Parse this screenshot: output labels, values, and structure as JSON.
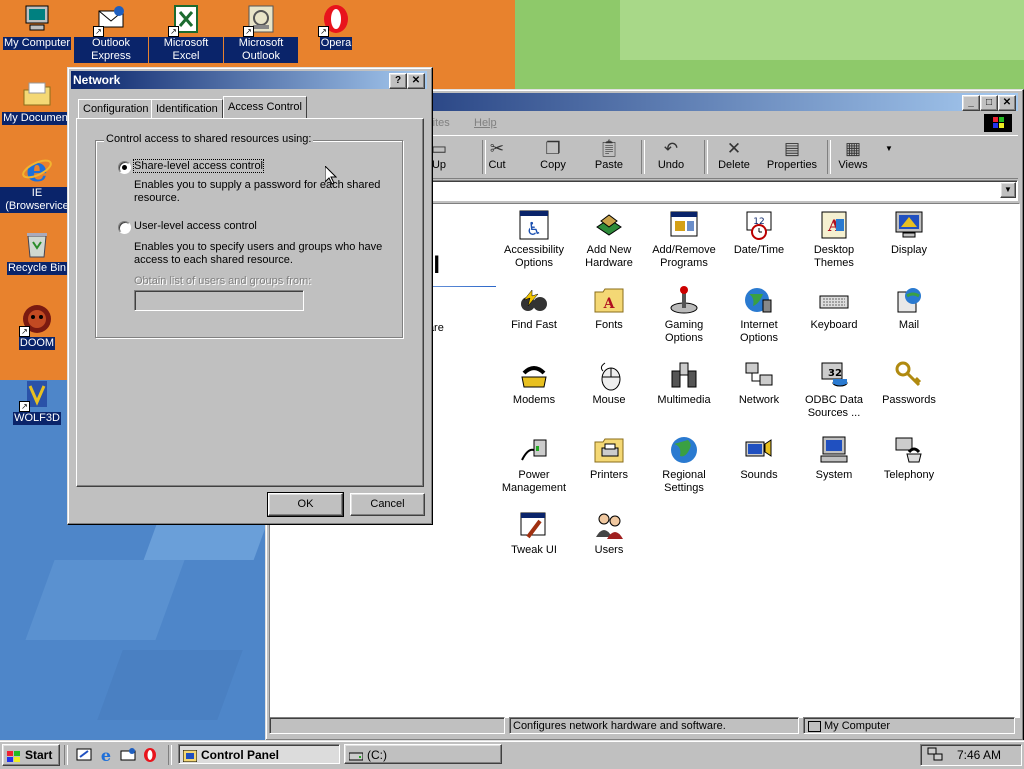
{
  "desktop": {
    "icons": [
      {
        "name": "my-computer-icon",
        "label": "My Computer"
      },
      {
        "name": "outlook-express-icon",
        "label": "Outlook Express"
      },
      {
        "name": "microsoft-excel-icon",
        "label": "Microsoft Excel"
      },
      {
        "name": "microsoft-outlook-icon",
        "label": "Microsoft Outlook"
      },
      {
        "name": "opera-icon",
        "label": "Opera"
      },
      {
        "name": "my-documents-icon",
        "label": "My Document"
      },
      {
        "name": "ie-browser-icon",
        "label": "IE (Browservice"
      },
      {
        "name": "recycle-bin-icon",
        "label": "Recycle Bin"
      },
      {
        "name": "doom-icon",
        "label": "DOOM"
      },
      {
        "name": "wolf3d-icon",
        "label": "WOLF3D"
      }
    ]
  },
  "control_panel": {
    "menu": {
      "favorites": "rites",
      "help": "Help"
    },
    "toolbar": {
      "up": "Up",
      "cut": "Cut",
      "copy": "Copy",
      "paste": "Paste",
      "undo": "Undo",
      "delete": "Delete",
      "properties": "Properties",
      "views": "Views"
    },
    "side_title": "el",
    "side_text": "ware",
    "items": [
      {
        "label": "Accessibility Options"
      },
      {
        "label": "Add New Hardware"
      },
      {
        "label": "Add/Remove Programs"
      },
      {
        "label": "Date/Time"
      },
      {
        "label": "Desktop Themes"
      },
      {
        "label": "Display"
      },
      {
        "label": "Find Fast"
      },
      {
        "label": "Fonts"
      },
      {
        "label": "Gaming Options"
      },
      {
        "label": "Internet Options"
      },
      {
        "label": "Keyboard"
      },
      {
        "label": "Mail"
      },
      {
        "label": "Modems"
      },
      {
        "label": "Mouse"
      },
      {
        "label": "Multimedia"
      },
      {
        "label": "Network"
      },
      {
        "label": "ODBC Data Sources ..."
      },
      {
        "label": "Passwords"
      },
      {
        "label": "Power Management"
      },
      {
        "label": "Printers"
      },
      {
        "label": "Regional Settings"
      },
      {
        "label": "Sounds"
      },
      {
        "label": "System"
      },
      {
        "label": "Telephony"
      },
      {
        "label": "Tweak UI"
      },
      {
        "label": "Users"
      }
    ],
    "status": {
      "message": "Configures network hardware and software.",
      "zone": "My Computer"
    }
  },
  "network_dialog": {
    "title": "Network",
    "help_button": "?",
    "close_button": "✕",
    "tabs": [
      "Configuration",
      "Identification",
      "Access Control"
    ],
    "active_tab": "Access Control",
    "group_label": "Control access to shared resources using:",
    "share_level": {
      "label": "Share-level access control",
      "description": "Enables you to supply a password for each shared resource.",
      "selected": true
    },
    "user_level": {
      "label": "User-level access control",
      "description": "Enables you to specify users and groups who have access to each shared resource.",
      "selected": false
    },
    "obtain_label": "Obtain list of users and groups from:",
    "obtain_value": "",
    "ok": "OK",
    "cancel": "Cancel"
  },
  "taskbar": {
    "start": "Start",
    "tasks": [
      {
        "label": "Control Panel",
        "active": true
      },
      {
        "label": "(C:)",
        "active": false
      }
    ],
    "clock": "7:46 AM"
  },
  "colors": {
    "title_active": "#0a246a",
    "face": "#c0c0c0",
    "desktop": "#3a6ea5",
    "selection": "#0a246a"
  }
}
